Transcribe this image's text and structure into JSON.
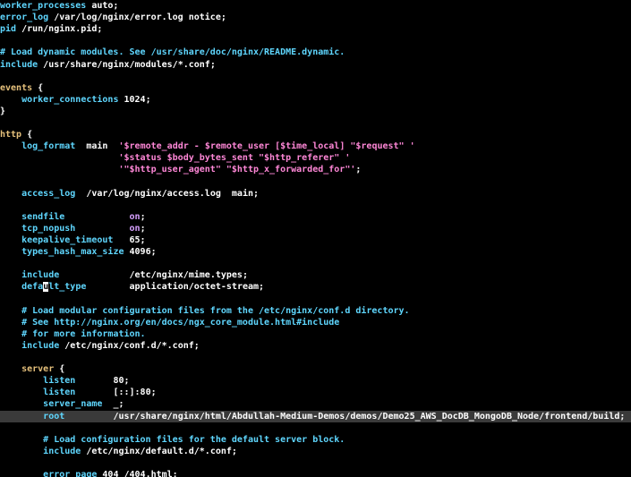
{
  "window": {
    "title": ""
  },
  "colors": {
    "background": "#000000",
    "directive": "#5fd7ff",
    "plain": "#ffffff",
    "keyword": "#e5c07b",
    "string": "#ff87d7",
    "value": "#d7a0ff",
    "comment": "#5fd7ff",
    "highlight": "#3a3a3a"
  },
  "editor": {
    "lines": [
      {
        "tokens": [
          {
            "text": "worker_processes",
            "k": "dir"
          },
          {
            "text": " auto;",
            "k": "plain"
          }
        ]
      },
      {
        "tokens": [
          {
            "text": "error_log",
            "k": "dir"
          },
          {
            "text": " /var/log/nginx/error.log notice;",
            "k": "plain"
          }
        ]
      },
      {
        "tokens": [
          {
            "text": "pid",
            "k": "dir"
          },
          {
            "text": " /run/nginx.pid;",
            "k": "plain"
          }
        ]
      },
      {
        "tokens": []
      },
      {
        "tokens": [
          {
            "text": "# Load dynamic modules. See /usr/share/doc/nginx/README.dynamic.",
            "k": "comment"
          }
        ]
      },
      {
        "tokens": [
          {
            "text": "include",
            "k": "dir"
          },
          {
            "text": " /usr/share/nginx/modules/*.conf;",
            "k": "plain"
          }
        ]
      },
      {
        "tokens": []
      },
      {
        "tokens": [
          {
            "text": "events",
            "k": "kw"
          },
          {
            "text": " {",
            "k": "plain"
          }
        ]
      },
      {
        "tokens": [
          {
            "text": "    ",
            "k": "plain"
          },
          {
            "text": "worker_connections",
            "k": "dir"
          },
          {
            "text": " 1024;",
            "k": "plain"
          }
        ]
      },
      {
        "tokens": [
          {
            "text": "}",
            "k": "plain"
          }
        ]
      },
      {
        "tokens": []
      },
      {
        "tokens": [
          {
            "text": "http",
            "k": "kw"
          },
          {
            "text": " {",
            "k": "plain"
          }
        ]
      },
      {
        "tokens": [
          {
            "text": "    ",
            "k": "plain"
          },
          {
            "text": "log_format",
            "k": "dir"
          },
          {
            "text": "  main  ",
            "k": "plain"
          },
          {
            "text": "'$remote_addr - $remote_user [$time_local] \"$request\" '",
            "k": "str"
          }
        ]
      },
      {
        "tokens": [
          {
            "text": "                      ",
            "k": "plain"
          },
          {
            "text": "'$status $body_bytes_sent \"$http_referer\" '",
            "k": "str"
          }
        ]
      },
      {
        "tokens": [
          {
            "text": "                      ",
            "k": "plain"
          },
          {
            "text": "'\"$http_user_agent\" \"$http_x_forwarded_for\"'",
            "k": "str"
          },
          {
            "text": ";",
            "k": "plain"
          }
        ]
      },
      {
        "tokens": []
      },
      {
        "tokens": [
          {
            "text": "    ",
            "k": "plain"
          },
          {
            "text": "access_log",
            "k": "dir"
          },
          {
            "text": "  /var/log/nginx/access.log  main;",
            "k": "plain"
          }
        ]
      },
      {
        "tokens": []
      },
      {
        "tokens": [
          {
            "text": "    ",
            "k": "plain"
          },
          {
            "text": "sendfile",
            "k": "dir"
          },
          {
            "text": "            ",
            "k": "plain"
          },
          {
            "text": "on",
            "k": "val"
          },
          {
            "text": ";",
            "k": "plain"
          }
        ]
      },
      {
        "tokens": [
          {
            "text": "    ",
            "k": "plain"
          },
          {
            "text": "tcp_nopush",
            "k": "dir"
          },
          {
            "text": "          ",
            "k": "plain"
          },
          {
            "text": "on",
            "k": "val"
          },
          {
            "text": ";",
            "k": "plain"
          }
        ]
      },
      {
        "tokens": [
          {
            "text": "    ",
            "k": "plain"
          },
          {
            "text": "keepalive_timeout",
            "k": "dir"
          },
          {
            "text": "   65;",
            "k": "plain"
          }
        ]
      },
      {
        "tokens": [
          {
            "text": "    ",
            "k": "plain"
          },
          {
            "text": "types_hash_max_size",
            "k": "dir"
          },
          {
            "text": " 4096;",
            "k": "plain"
          }
        ]
      },
      {
        "tokens": []
      },
      {
        "tokens": [
          {
            "text": "    ",
            "k": "plain"
          },
          {
            "text": "include",
            "k": "dir"
          },
          {
            "text": "             /etc/nginx/mime.types;",
            "k": "plain"
          }
        ]
      },
      {
        "tokens": [
          {
            "text": "    ",
            "k": "plain"
          },
          {
            "text": "defa",
            "k": "dir"
          },
          {
            "text": "u",
            "k": "cursor"
          },
          {
            "text": "lt_type",
            "k": "dir"
          },
          {
            "text": "        application/octet-stream;",
            "k": "plain"
          }
        ]
      },
      {
        "tokens": []
      },
      {
        "tokens": [
          {
            "text": "    # Load modular configuration files from the /etc/nginx/conf.d directory.",
            "k": "comment"
          }
        ]
      },
      {
        "tokens": [
          {
            "text": "    # See http://nginx.org/en/docs/ngx_core_module.html#include",
            "k": "comment"
          }
        ]
      },
      {
        "tokens": [
          {
            "text": "    # for more information.",
            "k": "comment"
          }
        ]
      },
      {
        "tokens": [
          {
            "text": "    ",
            "k": "plain"
          },
          {
            "text": "include",
            "k": "dir"
          },
          {
            "text": " /etc/nginx/conf.d/*.conf;",
            "k": "plain"
          }
        ]
      },
      {
        "tokens": []
      },
      {
        "tokens": [
          {
            "text": "    ",
            "k": "plain"
          },
          {
            "text": "server",
            "k": "kw"
          },
          {
            "text": " {",
            "k": "plain"
          }
        ]
      },
      {
        "tokens": [
          {
            "text": "        ",
            "k": "plain"
          },
          {
            "text": "listen",
            "k": "dir"
          },
          {
            "text": "       80;",
            "k": "plain"
          }
        ]
      },
      {
        "tokens": [
          {
            "text": "        ",
            "k": "plain"
          },
          {
            "text": "listen",
            "k": "dir"
          },
          {
            "text": "       [::]:80;",
            "k": "plain"
          }
        ]
      },
      {
        "tokens": [
          {
            "text": "        ",
            "k": "plain"
          },
          {
            "text": "server_name",
            "k": "dir"
          },
          {
            "text": "  _;",
            "k": "plain"
          }
        ]
      },
      {
        "highlight": true,
        "tokens": [
          {
            "text": "        ",
            "k": "plain"
          },
          {
            "text": "root",
            "k": "dir"
          },
          {
            "text": "         /usr/share/nginx/html/Abdullah-Medium-Demos/demos/Demo25_AWS_DocDB_MongoDB_Node/frontend/build;",
            "k": "plain"
          }
        ]
      },
      {
        "tokens": []
      },
      {
        "tokens": [
          {
            "text": "        # Load configuration files for the default server block.",
            "k": "comment"
          }
        ]
      },
      {
        "tokens": [
          {
            "text": "        ",
            "k": "plain"
          },
          {
            "text": "include",
            "k": "dir"
          },
          {
            "text": " /etc/nginx/default.d/*.conf;",
            "k": "plain"
          }
        ]
      },
      {
        "tokens": []
      },
      {
        "tokens": [
          {
            "text": "        ",
            "k": "plain"
          },
          {
            "text": "error_page",
            "k": "dir"
          },
          {
            "text": " 404 /404.html;",
            "k": "plain"
          }
        ]
      }
    ]
  }
}
